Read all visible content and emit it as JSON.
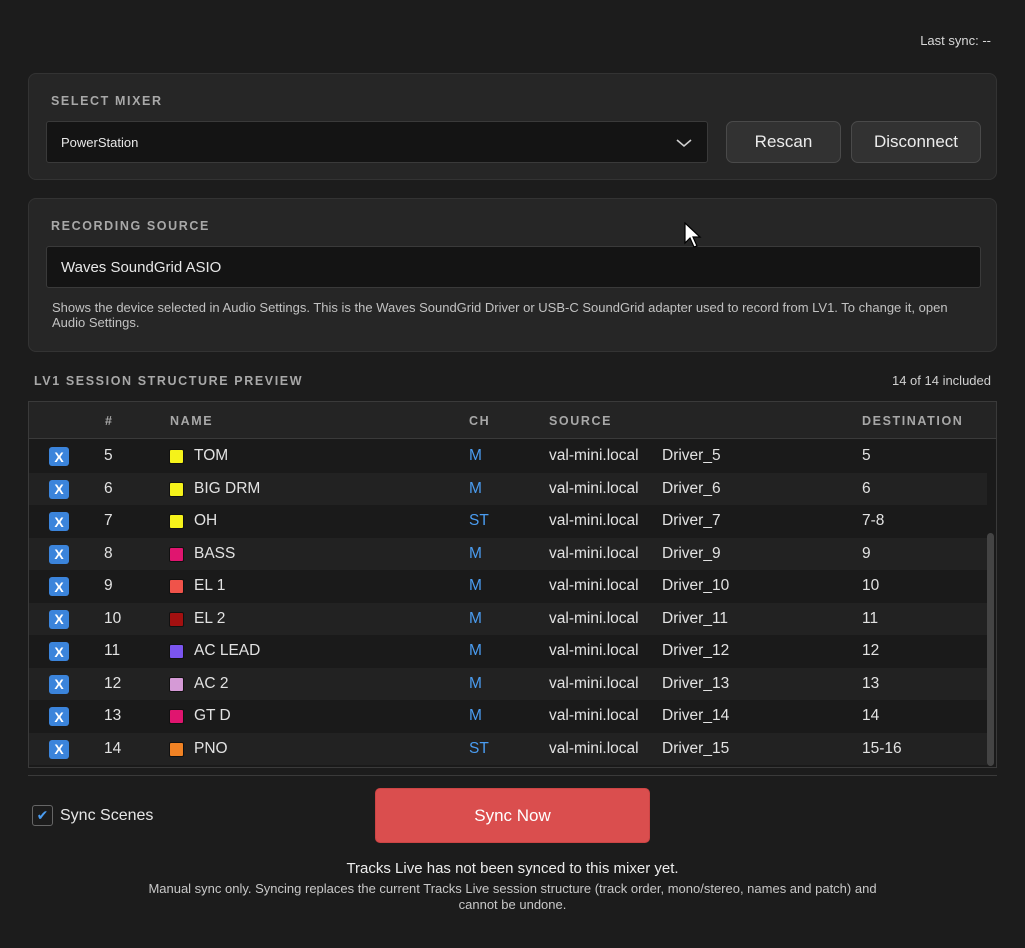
{
  "last_sync": "Last sync: --",
  "mixer": {
    "label": "SELECT MIXER",
    "selected": "PowerStation",
    "rescan_label": "Rescan",
    "disconnect_label": "Disconnect"
  },
  "recording_source": {
    "label": "RECORDING SOURCE",
    "value": "Waves SoundGrid ASIO",
    "help": "Shows the device selected in Audio Settings. This is the Waves SoundGrid Driver or USB-C SoundGrid adapter used to record from LV1. To change it, open Audio Settings."
  },
  "preview": {
    "label": "LV1 SESSION STRUCTURE PREVIEW",
    "included": "14 of 14 included",
    "columns": [
      "#",
      "NAME",
      "CH",
      "SOURCE",
      "DESTINATION"
    ],
    "rows": [
      {
        "check": "X",
        "num": "5",
        "name": "TOM",
        "color": "#f5f21a",
        "ch": "M",
        "host": "val-mini.local",
        "driver": "Driver_5",
        "dest": "5"
      },
      {
        "check": "X",
        "num": "6",
        "name": "BIG DRM",
        "color": "#f5f21a",
        "ch": "M",
        "host": "val-mini.local",
        "driver": "Driver_6",
        "dest": "6"
      },
      {
        "check": "X",
        "num": "7",
        "name": "OH",
        "color": "#f5f21a",
        "ch": "ST",
        "host": "val-mini.local",
        "driver": "Driver_7",
        "dest": "7-8"
      },
      {
        "check": "X",
        "num": "8",
        "name": "BASS",
        "color": "#e0156f",
        "ch": "M",
        "host": "val-mini.local",
        "driver": "Driver_9",
        "dest": "9"
      },
      {
        "check": "X",
        "num": "9",
        "name": "EL 1",
        "color": "#f0534a",
        "ch": "M",
        "host": "val-mini.local",
        "driver": "Driver_10",
        "dest": "10"
      },
      {
        "check": "X",
        "num": "10",
        "name": "EL 2",
        "color": "#a31010",
        "ch": "M",
        "host": "val-mini.local",
        "driver": "Driver_11",
        "dest": "11"
      },
      {
        "check": "X",
        "num": "11",
        "name": "AC LEAD",
        "color": "#7b55f0",
        "ch": "M",
        "host": "val-mini.local",
        "driver": "Driver_12",
        "dest": "12"
      },
      {
        "check": "X",
        "num": "12",
        "name": "AC 2",
        "color": "#d59ad6",
        "ch": "M",
        "host": "val-mini.local",
        "driver": "Driver_13",
        "dest": "13"
      },
      {
        "check": "X",
        "num": "13",
        "name": "GT D",
        "color": "#e0156f",
        "ch": "M",
        "host": "val-mini.local",
        "driver": "Driver_14",
        "dest": "14"
      },
      {
        "check": "X",
        "num": "14",
        "name": "PNO",
        "color": "#f08224",
        "ch": "ST",
        "host": "val-mini.local",
        "driver": "Driver_15",
        "dest": "15-16"
      }
    ]
  },
  "sync_scenes_label": "Sync Scenes",
  "sync_scenes_checked": true,
  "sync_now_label": "Sync Now",
  "status_main": "Tracks Live has not been synced to this mixer yet.",
  "status_note": "Manual sync only. Syncing replaces the current Tracks Live session structure (track order, mono/stereo, names and patch) and cannot be undone.",
  "colors": {
    "accent": "#3b84db",
    "sync_button": "#da4e4e",
    "background": "#1c1c1c"
  }
}
